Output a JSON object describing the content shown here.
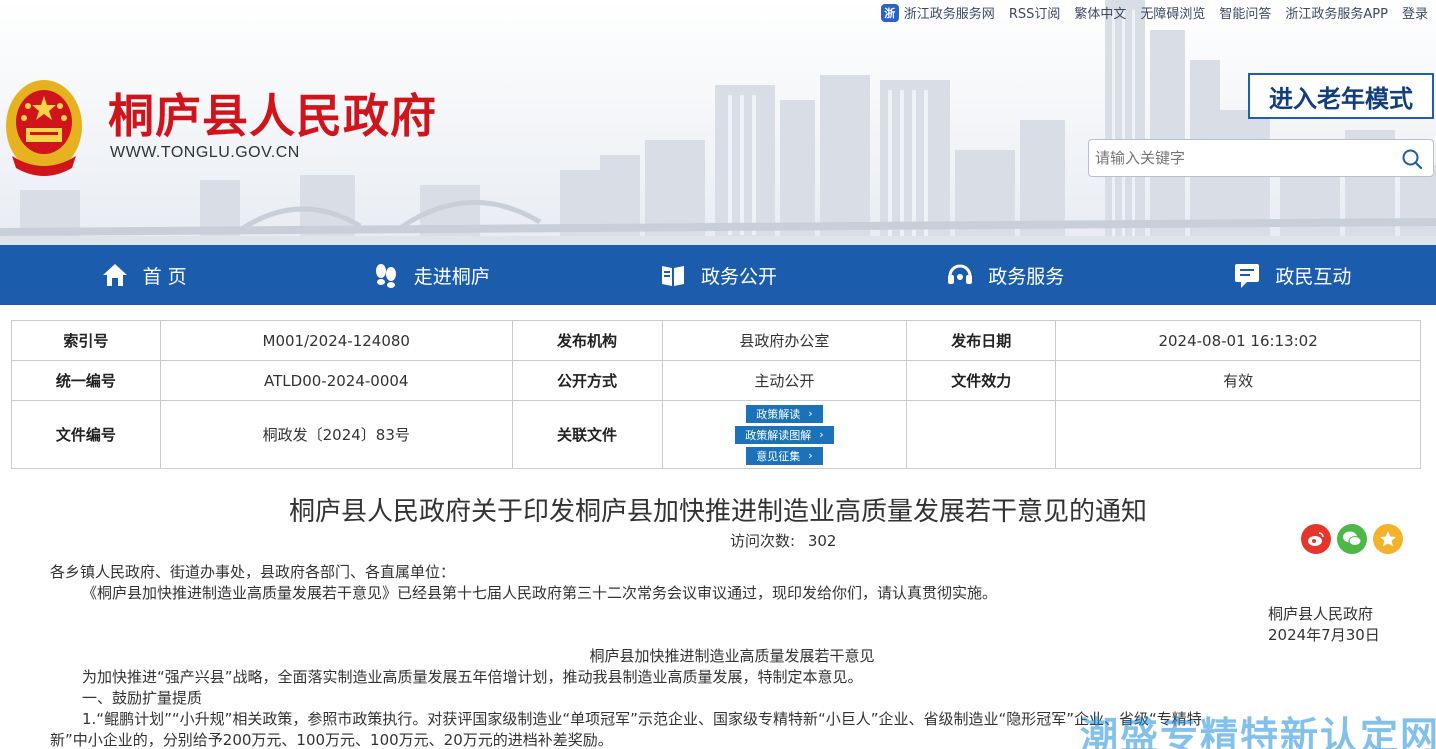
{
  "topbar": {
    "items": [
      {
        "label": "浙江政务服务网",
        "icon": "zhejiang-service-icon"
      },
      {
        "label": "RSS订阅"
      },
      {
        "label": "繁体中文"
      },
      {
        "label": "无障碍浏览"
      },
      {
        "label": "智能问答"
      },
      {
        "label": "浙江政务服务APP"
      },
      {
        "label": "登录"
      }
    ]
  },
  "header": {
    "title": "桐庐县人民政府",
    "url": "WWW.TONGLU.GOV.CN",
    "elder_mode": "进入老年模式",
    "search_placeholder": "请输入关键字"
  },
  "nav": {
    "items": [
      {
        "label": "首 页",
        "icon": "home-icon"
      },
      {
        "label": "走进桐庐",
        "icon": "footprints-icon"
      },
      {
        "label": "政务公开",
        "icon": "book-icon"
      },
      {
        "label": "政务服务",
        "icon": "headset-icon"
      },
      {
        "label": "政民互动",
        "icon": "chat-icon"
      }
    ]
  },
  "meta": {
    "index_label": "索引号",
    "index_value": "M001/2024-124080",
    "org_label": "发布机构",
    "org_value": "县政府办公室",
    "date_label": "发布日期",
    "date_value": "2024-08-01 16:13:02",
    "uid_label": "统一编号",
    "uid_value": "ATLD00-2024-0004",
    "mode_label": "公开方式",
    "mode_value": "主动公开",
    "validity_label": "文件效力",
    "validity_value": "有效",
    "docno_label": "文件编号",
    "docno_value": "桐政发〔2024〕83号",
    "related_label": "关联文件",
    "related": [
      "政策解读",
      "政策解读图解",
      "意见征集"
    ]
  },
  "article": {
    "title": "桐庐县人民政府关于印发桐庐县加快推进制造业高质量发展若干意见的通知",
    "visits_label": "访问次数:",
    "visits": "302",
    "salutation": "各乡镇人民政府、街道办事处，县政府各部门、各直属单位：",
    "body1": "《桐庐县加快推进制造业高质量发展若干意见》已经县第十七届人民政府第三十二次常务会议审议通过，现印发给你们，请认真贯彻实施。",
    "signer": "桐庐县人民政府",
    "sign_date": "2024年7月30日",
    "sub_title": "桐庐县加快推进制造业高质量发展若干意见",
    "para1": "为加快推进“强产兴县”战略，全面落实制造业高质量发展五年倍增计划，推动我县制造业高质量发展，特制定本意见。",
    "section1": "一、鼓励扩量提质",
    "item1_a": "1.“鲲鹏计划”“小升规”相关政策，参照市政策执行。对获评国家级制造业“单项冠军”示范企业、国家级专精特新“小巨人”企业、省级制造业“隐形冠军”企业、省级“专精特",
    "item1_b": "新”中小企业的，分别给予200万元、100万元、100万元、20万元的进档补差奖励。"
  },
  "watermark": "潮盛专精特新认定网"
}
